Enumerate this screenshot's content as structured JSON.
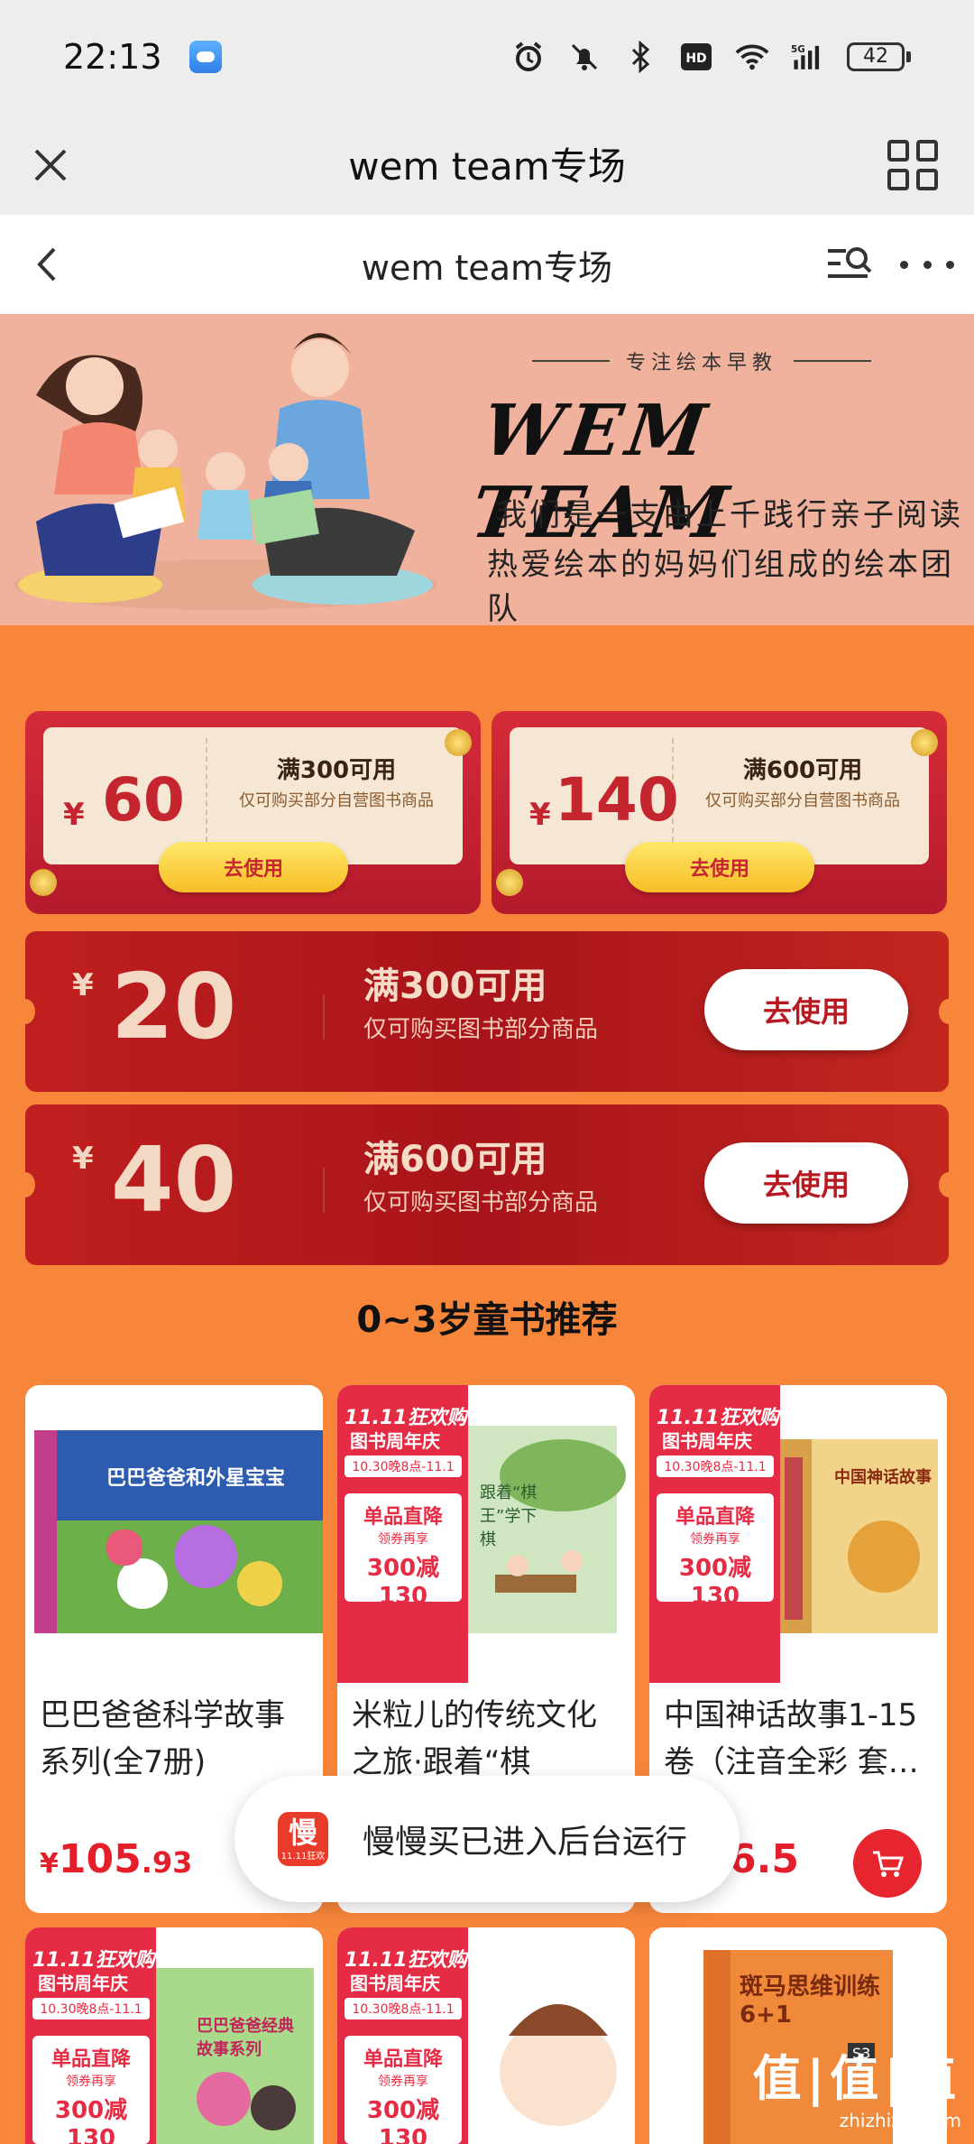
{
  "status_bar": {
    "time": "22:13",
    "battery": "42",
    "icons": [
      "weather-icon",
      "alarm-icon",
      "mute-icon",
      "bluetooth-icon",
      "hd-icon",
      "wifi-icon",
      "signal-5g-icon",
      "battery-icon"
    ]
  },
  "mini_program_bar": {
    "title": "wem team专场"
  },
  "nav": {
    "title": "wem team专场"
  },
  "banner": {
    "tagline": "专注绘本早教",
    "title": "WEM TEAM",
    "line1": "我们是一支由上千践行亲子阅读",
    "line2": "热爱绘本的妈妈们组成的绘本团队"
  },
  "coupons_top": [
    {
      "currency": "¥",
      "amount": "60",
      "condition": "满300可用",
      "desc": "仅可购买部分自营图书商品",
      "button": "去使用"
    },
    {
      "currency": "¥",
      "amount": "140",
      "condition": "满600可用",
      "desc": "仅可购买部分自营图书商品",
      "button": "去使用"
    }
  ],
  "coupons_wide": [
    {
      "currency": "¥",
      "amount": "20",
      "condition": "满300可用",
      "desc": "仅可购买图书部分商品",
      "button": "去使用"
    },
    {
      "currency": "¥",
      "amount": "40",
      "condition": "满600可用",
      "desc": "仅可购买图书部分商品",
      "button": "去使用"
    }
  ],
  "section_title": "0~3岁童书推荐",
  "products": [
    {
      "name": "巴巴爸爸科学故事系列(全7册)",
      "price_symbol": "¥",
      "price_int": "105",
      "price_dec": ".93",
      "cover_text": "巴巴爸爸和外星宝宝"
    },
    {
      "name": "米粒儿的传统文化之旅·跟着“棋王”学…",
      "cover_text": "跟着“棋王”学下棋"
    },
    {
      "name": "中国神话故事1-15卷（注音全彩 套…",
      "price_tail": "6.5",
      "cover_text": "中国神话故事"
    }
  ],
  "products_row2": [
    {
      "cover_text": "巴巴爸爸经典故事系列"
    },
    {
      "cover_text": ""
    },
    {
      "cover_text": "斑马思维训练6+1",
      "badge": "S3"
    }
  ],
  "promo": {
    "t1": "11.11狂欢购",
    "t2": "图书周年庆",
    "t3": "10.30晚8点-11.1",
    "a": "单品直降",
    "b": "领券再享",
    "c": "300减130"
  },
  "toast": {
    "icon_big": "慢",
    "icon_small": "11.11狂欢",
    "text": "慢慢买已进入后台运行"
  },
  "watermark": {
    "line1": "值|值|值",
    "line2": "zhizhizhi.com"
  },
  "colors": {
    "page_bg": "#f7863a",
    "coupon_red": "#b51a2b",
    "price_red": "#e41f2b"
  }
}
